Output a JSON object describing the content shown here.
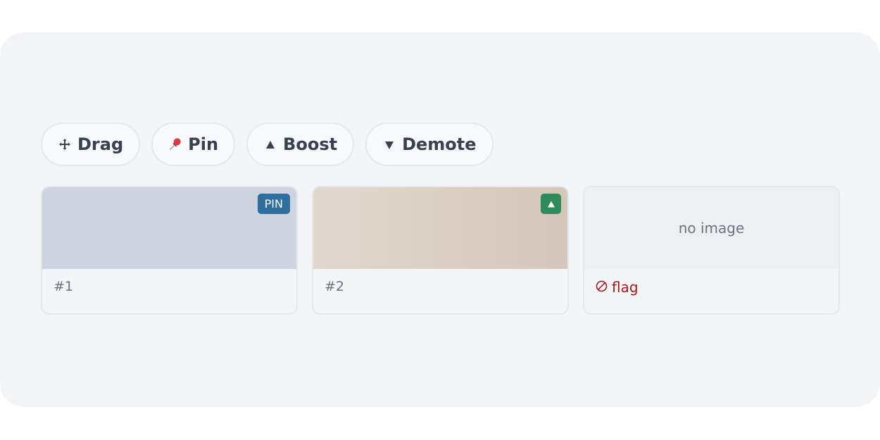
{
  "toolbar": {
    "buttons": [
      {
        "label": "Drag",
        "icon": "move-arrows-icon"
      },
      {
        "label": "Pin",
        "icon": "pushpin-icon"
      },
      {
        "label": "Boost",
        "icon": "triangle-up-icon"
      },
      {
        "label": "Demote",
        "icon": "triangle-down-icon"
      }
    ]
  },
  "cards": [
    {
      "caption": "#1",
      "badge": "PIN",
      "thumb_color": "#cdd3df"
    },
    {
      "caption": "#2",
      "badge_icon": "triangle-up-icon",
      "thumb_color": "#dbd0c6"
    },
    {
      "placeholder": "no image",
      "action": "flag",
      "action_icon": "prohibited-icon"
    }
  ],
  "colors": {
    "panel": "#f3f4f6",
    "pin_badge": "#2f6f9f",
    "boost_badge": "#2e8b5a",
    "flag": "#a31d1d",
    "text": "#374151"
  }
}
